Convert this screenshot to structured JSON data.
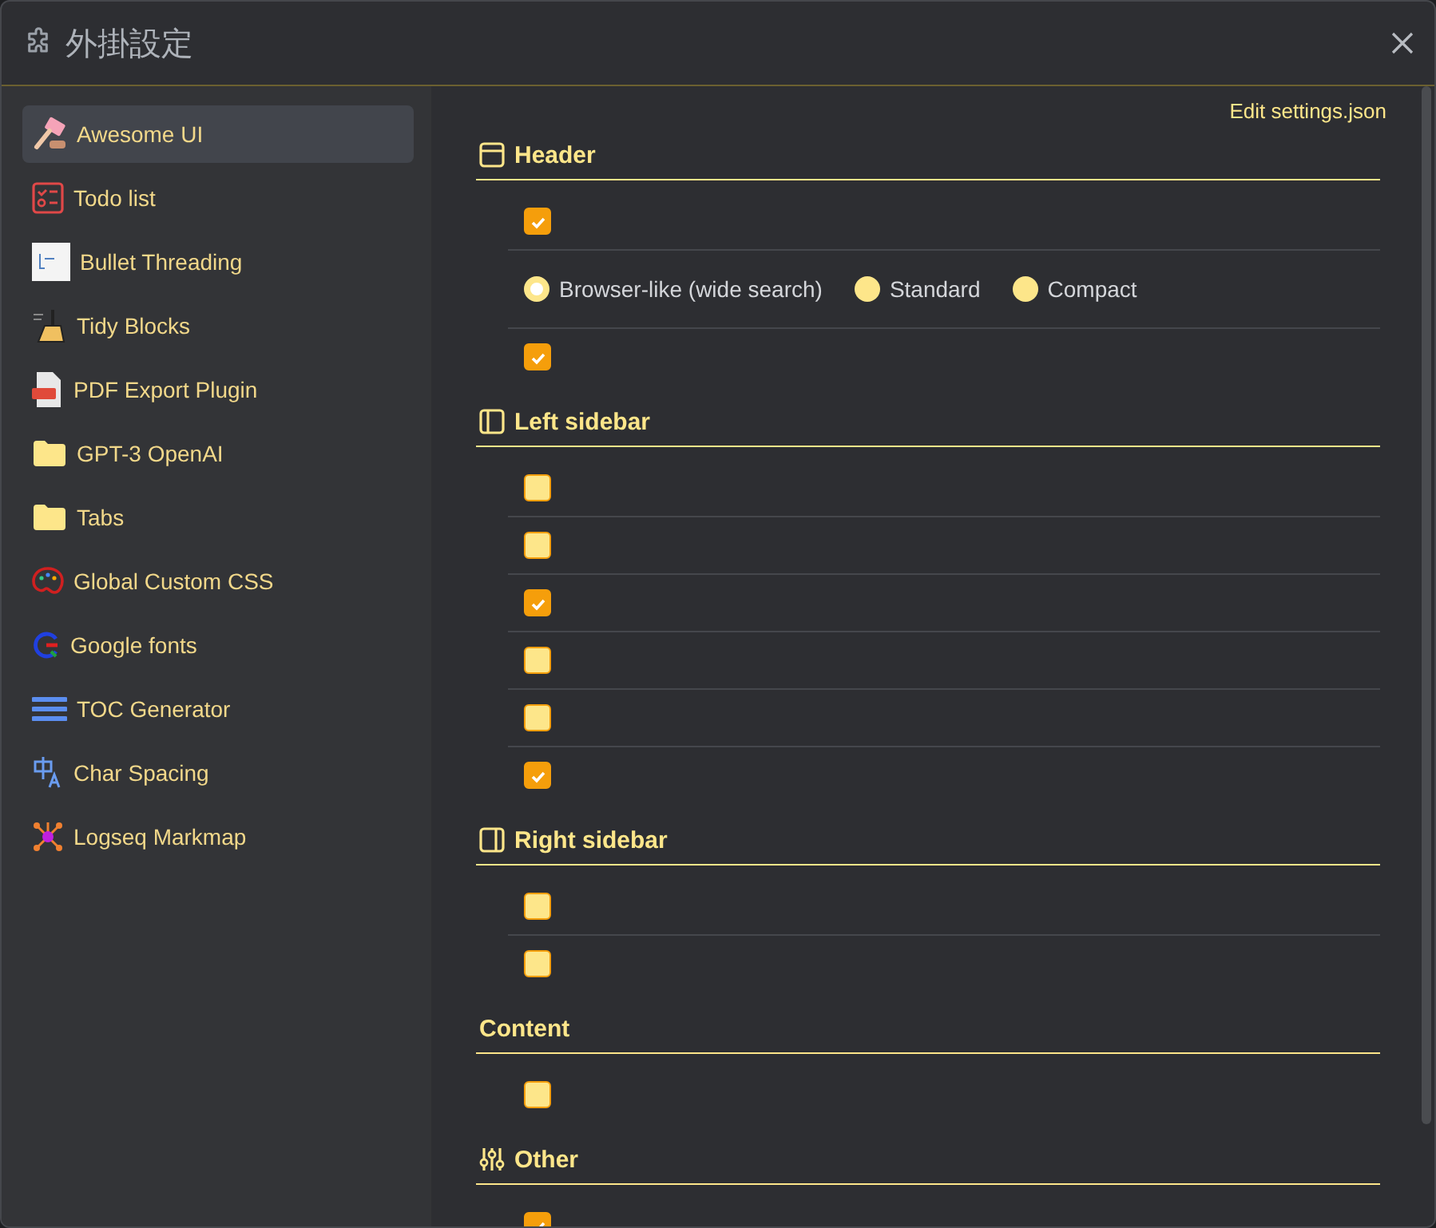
{
  "window": {
    "title": "外掛設定"
  },
  "sidebar": {
    "items": [
      {
        "label": "Awesome UI",
        "selected": true
      },
      {
        "label": "Todo list",
        "selected": false
      },
      {
        "label": "Bullet Threading",
        "selected": false
      },
      {
        "label": "Tidy Blocks",
        "selected": false
      },
      {
        "label": "PDF Export Plugin",
        "selected": false
      },
      {
        "label": "GPT-3 OpenAI",
        "selected": false
      },
      {
        "label": "Tabs",
        "selected": false
      },
      {
        "label": "Global Custom CSS",
        "selected": false
      },
      {
        "label": "Google fonts",
        "selected": false
      },
      {
        "label": "TOC Generator",
        "selected": false
      },
      {
        "label": "Char Spacing",
        "selected": false
      },
      {
        "label": "Logseq Markmap",
        "selected": false
      }
    ]
  },
  "edit_link": "Edit settings.json",
  "sections": [
    {
      "title": "Header",
      "rows": [
        {
          "kind": "checkbox",
          "checked": true
        },
        {
          "kind": "radio",
          "options": [
            {
              "label": "Browser-like (wide search)",
              "selected": true
            },
            {
              "label": "Standard",
              "selected": false
            },
            {
              "label": "Compact",
              "selected": false
            }
          ]
        },
        {
          "kind": "checkbox",
          "checked": true
        }
      ]
    },
    {
      "title": "Left sidebar",
      "rows": [
        {
          "kind": "checkbox",
          "checked": false
        },
        {
          "kind": "checkbox",
          "checked": false
        },
        {
          "kind": "checkbox",
          "checked": true
        },
        {
          "kind": "checkbox",
          "checked": false
        },
        {
          "kind": "checkbox",
          "checked": false
        },
        {
          "kind": "checkbox",
          "checked": true
        }
      ]
    },
    {
      "title": "Right sidebar",
      "rows": [
        {
          "kind": "checkbox",
          "checked": false
        },
        {
          "kind": "checkbox",
          "checked": false
        }
      ]
    },
    {
      "title": "Content",
      "rows": [
        {
          "kind": "checkbox",
          "checked": false
        }
      ]
    },
    {
      "title": "Other",
      "rows": [
        {
          "kind": "checkbox",
          "checked": true
        }
      ]
    }
  ]
}
